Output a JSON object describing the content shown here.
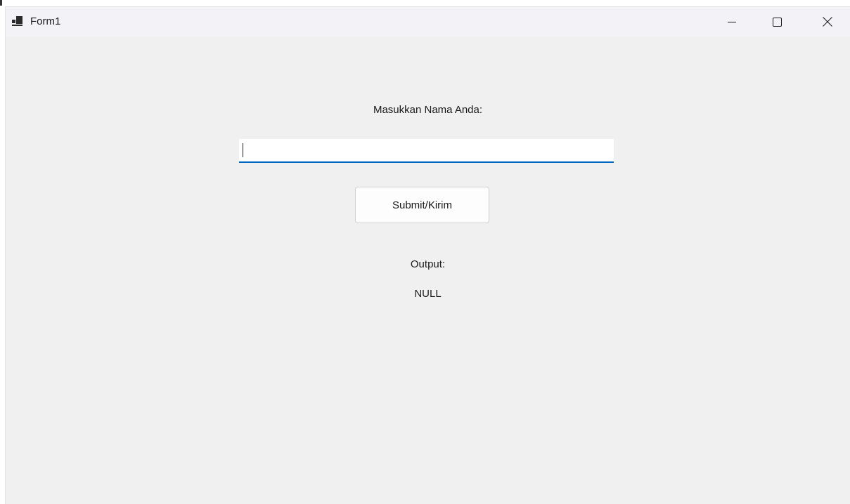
{
  "window": {
    "title": "Form1",
    "icon": "app-form-icon",
    "controls": {
      "minimize": "minimize-icon",
      "maximize": "maximize-icon",
      "close": "close-icon"
    }
  },
  "form": {
    "prompt_label": "Masukkan Nama Anda:",
    "name_input": {
      "value": "",
      "placeholder": ""
    },
    "submit_label": "Submit/Kirim",
    "output_label": "Output:",
    "output_value": "NULL"
  },
  "colors": {
    "accent": "#0067c0",
    "client_background": "#f0f0f0",
    "titlebar_background": "#f3f3f7"
  }
}
